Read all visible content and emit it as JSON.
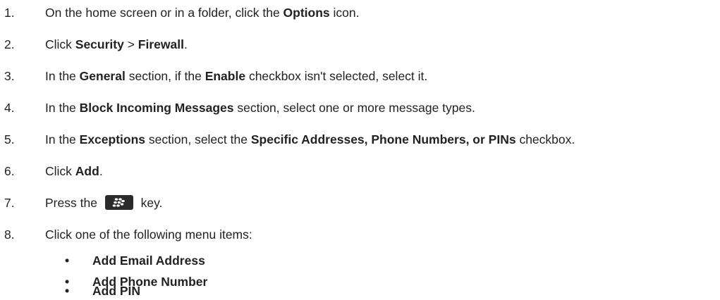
{
  "steps": [
    {
      "num": "1.",
      "parts": [
        "On the home screen or in a folder, click the ",
        "Options",
        " icon."
      ]
    },
    {
      "num": "2.",
      "parts": [
        "Click ",
        "Security",
        " > ",
        "Firewall",
        "."
      ]
    },
    {
      "num": "3.",
      "parts": [
        "In the ",
        "General",
        " section, if the ",
        "Enable",
        " checkbox isn't selected, select it."
      ]
    },
    {
      "num": "4.",
      "parts": [
        "In the ",
        "Block Incoming Messages",
        " section, select one or more message types."
      ]
    },
    {
      "num": "5.",
      "parts": [
        "In the ",
        "Exceptions",
        " section, select the ",
        "Specific Addresses, Phone Numbers, or PINs",
        " checkbox."
      ]
    },
    {
      "num": "6.",
      "parts": [
        "Click ",
        "Add",
        "."
      ]
    },
    {
      "num": "7.",
      "parts": [
        "Press the ",
        " key."
      ],
      "icon": "blackberry-menu-key-icon"
    },
    {
      "num": "8.",
      "parts": [
        "Click one of the following menu items:"
      ]
    }
  ],
  "menu_items": [
    {
      "bullet": "•",
      "label": "Add Email Address"
    },
    {
      "bullet": "•",
      "label": "Add Phone Number"
    },
    {
      "bullet": "•",
      "label": "Add PIN"
    }
  ],
  "colors": {
    "text": "#222222",
    "key_background": "#2b2b2b",
    "key_glyph": "#ffffff"
  }
}
